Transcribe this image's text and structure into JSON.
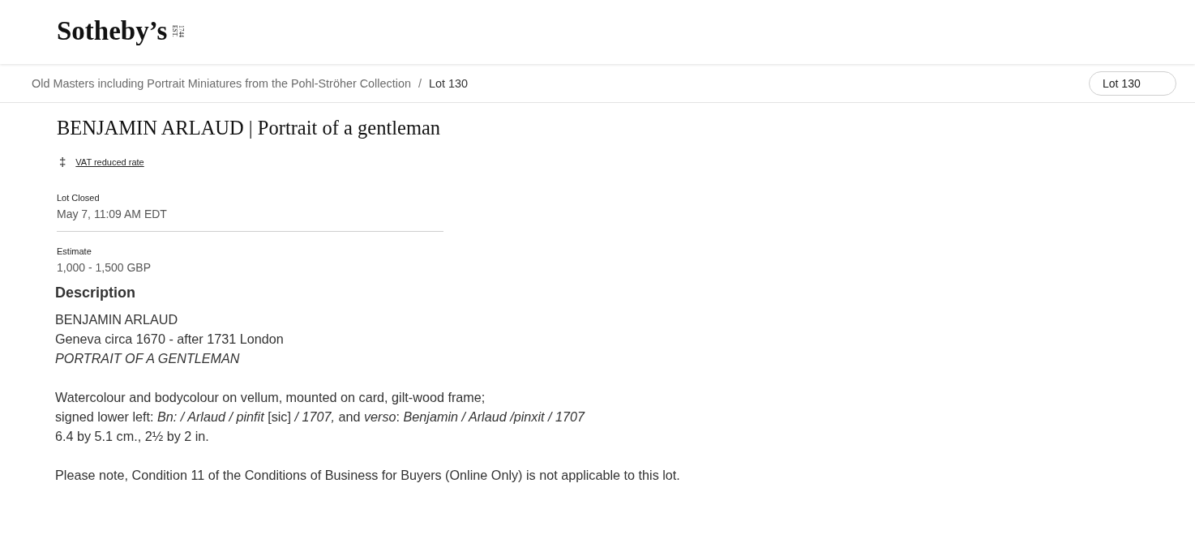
{
  "header": {
    "logo": {
      "wordmark": "Sotheby’s",
      "established": [
        "EST.",
        "1744"
      ]
    }
  },
  "breadcrumb": {
    "items": [
      {
        "label": "Old Masters including Portrait Miniatures from the Pohl-Ströher Collection",
        "kind": "link"
      },
      {
        "label": "Lot 130",
        "kind": "current"
      }
    ],
    "separator": "/",
    "lot_field": {
      "value": "Lot 130"
    }
  },
  "lot": {
    "title": "BENJAMIN ARLAUD | Portrait of a gentleman",
    "tax": {
      "symbol": "‡",
      "link": "VAT reduced rate"
    },
    "details": [
      {
        "label": "Lot Closed",
        "value": "May 7, 11:09 AM EDT"
      },
      {
        "label": "Estimate",
        "value": "1,000 - 1,500 GBP"
      }
    ]
  },
  "description": {
    "heading": "Description",
    "paragraphs": [
      [
        {
          "text": "BENJAMIN ARLAUD",
          "italic": false
        },
        {
          "text": "Geneva circa 1670 - after 1731 London",
          "italic": false
        },
        {
          "text": "PORTRAIT OF A GENTLEMAN",
          "italic": true
        }
      ],
      [
        {
          "text": "Watercolour and bodycolour on vellum, mounted on card, gilt-wood frame;",
          "italic": false
        },
        {
          "text": "signed lower left: *Bn: / Arlaud / pinfit* [sic] */ 1707,* and *verso*: *Benjamin / Arlaud /pinxit / 1707*",
          "italic": false
        },
        {
          "text": "6.4 by 5.1 cm., 2½ by 2 in.",
          "italic": false
        }
      ],
      [
        {
          "text": "Please note, Condition 11 of the Conditions of Business for Buyers (Online Only) is not applicable to this lot.",
          "italic": false
        }
      ]
    ]
  }
}
